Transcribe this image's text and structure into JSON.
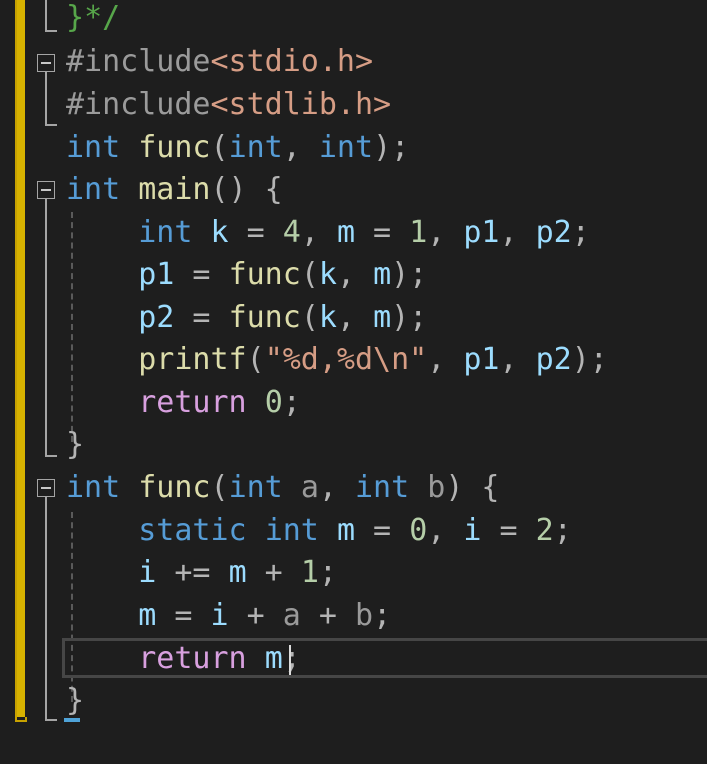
{
  "editor": {
    "lines": [
      {
        "tokens": [
          {
            "t": "}",
            "c": "tok-cmt"
          },
          {
            "t": "*/",
            "c": "tok-cmt"
          }
        ]
      },
      {
        "tokens": [
          {
            "t": "#include",
            "c": "tok-pre"
          },
          {
            "t": "<stdio.h>",
            "c": "tok-inc"
          }
        ]
      },
      {
        "tokens": [
          {
            "t": "#include",
            "c": "tok-pre"
          },
          {
            "t": "<stdlib.h>",
            "c": "tok-inc"
          }
        ]
      },
      {
        "tokens": [
          {
            "t": "int",
            "c": "tok-kw"
          },
          {
            "t": " ",
            "c": ""
          },
          {
            "t": "func",
            "c": "tok-fn"
          },
          {
            "t": "(",
            "c": "tok-punc"
          },
          {
            "t": "int",
            "c": "tok-kw"
          },
          {
            "t": ", ",
            "c": "tok-punc"
          },
          {
            "t": "int",
            "c": "tok-kw"
          },
          {
            "t": ");",
            "c": "tok-punc"
          }
        ]
      },
      {
        "tokens": [
          {
            "t": "int",
            "c": "tok-kw"
          },
          {
            "t": " ",
            "c": ""
          },
          {
            "t": "main",
            "c": "tok-fn"
          },
          {
            "t": "() {",
            "c": "tok-punc"
          }
        ]
      },
      {
        "tokens": [
          {
            "t": "    ",
            "c": ""
          },
          {
            "t": "int",
            "c": "tok-kw"
          },
          {
            "t": " ",
            "c": ""
          },
          {
            "t": "k",
            "c": "tok-var"
          },
          {
            "t": " = ",
            "c": "tok-punc"
          },
          {
            "t": "4",
            "c": "tok-num"
          },
          {
            "t": ", ",
            "c": "tok-punc"
          },
          {
            "t": "m",
            "c": "tok-var"
          },
          {
            "t": " = ",
            "c": "tok-punc"
          },
          {
            "t": "1",
            "c": "tok-num"
          },
          {
            "t": ", ",
            "c": "tok-punc"
          },
          {
            "t": "p1",
            "c": "tok-var"
          },
          {
            "t": ", ",
            "c": "tok-punc"
          },
          {
            "t": "p2",
            "c": "tok-var"
          },
          {
            "t": ";",
            "c": "tok-punc"
          }
        ]
      },
      {
        "tokens": [
          {
            "t": "    ",
            "c": ""
          },
          {
            "t": "p1",
            "c": "tok-var"
          },
          {
            "t": " = ",
            "c": "tok-punc"
          },
          {
            "t": "func",
            "c": "tok-fn"
          },
          {
            "t": "(",
            "c": "tok-punc"
          },
          {
            "t": "k",
            "c": "tok-var"
          },
          {
            "t": ", ",
            "c": "tok-punc"
          },
          {
            "t": "m",
            "c": "tok-var"
          },
          {
            "t": ");",
            "c": "tok-punc"
          }
        ]
      },
      {
        "tokens": [
          {
            "t": "    ",
            "c": ""
          },
          {
            "t": "p2",
            "c": "tok-var"
          },
          {
            "t": " = ",
            "c": "tok-punc"
          },
          {
            "t": "func",
            "c": "tok-fn"
          },
          {
            "t": "(",
            "c": "tok-punc"
          },
          {
            "t": "k",
            "c": "tok-var"
          },
          {
            "t": ", ",
            "c": "tok-punc"
          },
          {
            "t": "m",
            "c": "tok-var"
          },
          {
            "t": ");",
            "c": "tok-punc"
          }
        ]
      },
      {
        "tokens": [
          {
            "t": "    ",
            "c": ""
          },
          {
            "t": "printf",
            "c": "tok-fn"
          },
          {
            "t": "(",
            "c": "tok-punc"
          },
          {
            "t": "\"%d,%d\\n\"",
            "c": "tok-str"
          },
          {
            "t": ", ",
            "c": "tok-punc"
          },
          {
            "t": "p1",
            "c": "tok-var"
          },
          {
            "t": ", ",
            "c": "tok-punc"
          },
          {
            "t": "p2",
            "c": "tok-var"
          },
          {
            "t": ");",
            "c": "tok-punc"
          }
        ]
      },
      {
        "tokens": [
          {
            "t": "    ",
            "c": ""
          },
          {
            "t": "return",
            "c": "tok-ctrl"
          },
          {
            "t": " ",
            "c": ""
          },
          {
            "t": "0",
            "c": "tok-num"
          },
          {
            "t": ";",
            "c": "tok-punc"
          }
        ]
      },
      {
        "tokens": [
          {
            "t": "}",
            "c": "tok-punc"
          }
        ]
      },
      {
        "tokens": [
          {
            "t": "int",
            "c": "tok-kw"
          },
          {
            "t": " ",
            "c": ""
          },
          {
            "t": "func",
            "c": "tok-fn"
          },
          {
            "t": "(",
            "c": "tok-punc"
          },
          {
            "t": "int",
            "c": "tok-kw"
          },
          {
            "t": " ",
            "c": ""
          },
          {
            "t": "a",
            "c": "tok-param"
          },
          {
            "t": ", ",
            "c": "tok-punc"
          },
          {
            "t": "int",
            "c": "tok-kw"
          },
          {
            "t": " ",
            "c": ""
          },
          {
            "t": "b",
            "c": "tok-param"
          },
          {
            "t": ") {",
            "c": "tok-punc"
          }
        ]
      },
      {
        "tokens": [
          {
            "t": "    ",
            "c": ""
          },
          {
            "t": "static",
            "c": "tok-kw"
          },
          {
            "t": " ",
            "c": ""
          },
          {
            "t": "int",
            "c": "tok-kw"
          },
          {
            "t": " ",
            "c": ""
          },
          {
            "t": "m",
            "c": "tok-var"
          },
          {
            "t": " = ",
            "c": "tok-punc"
          },
          {
            "t": "0",
            "c": "tok-num"
          },
          {
            "t": ", ",
            "c": "tok-punc"
          },
          {
            "t": "i",
            "c": "tok-var"
          },
          {
            "t": " = ",
            "c": "tok-punc"
          },
          {
            "t": "2",
            "c": "tok-num"
          },
          {
            "t": ";",
            "c": "tok-punc"
          }
        ]
      },
      {
        "tokens": [
          {
            "t": "    ",
            "c": ""
          },
          {
            "t": "i",
            "c": "tok-var"
          },
          {
            "t": " += ",
            "c": "tok-punc"
          },
          {
            "t": "m",
            "c": "tok-var"
          },
          {
            "t": " + ",
            "c": "tok-punc"
          },
          {
            "t": "1",
            "c": "tok-num"
          },
          {
            "t": ";",
            "c": "tok-punc"
          }
        ]
      },
      {
        "tokens": [
          {
            "t": "    ",
            "c": ""
          },
          {
            "t": "m",
            "c": "tok-var"
          },
          {
            "t": " = ",
            "c": "tok-punc"
          },
          {
            "t": "i",
            "c": "tok-var"
          },
          {
            "t": " + ",
            "c": "tok-punc"
          },
          {
            "t": "a",
            "c": "tok-param"
          },
          {
            "t": " + ",
            "c": "tok-punc"
          },
          {
            "t": "b",
            "c": "tok-param"
          },
          {
            "t": ";",
            "c": "tok-punc"
          }
        ]
      },
      {
        "tokens": [
          {
            "t": "    ",
            "c": ""
          },
          {
            "t": "return",
            "c": "tok-ctrl"
          },
          {
            "t": " ",
            "c": ""
          },
          {
            "t": "m",
            "c": "tok-var"
          },
          {
            "t": ";",
            "c": "tok-punc"
          }
        ]
      },
      {
        "tokens": [
          {
            "t": "}",
            "c": "tok-punc"
          }
        ]
      }
    ],
    "fold_icons": [
      "collapse-icon",
      "collapse-icon",
      "collapse-icon"
    ],
    "colors": {
      "background": "#1e1e1e",
      "keyword": "#569cd6",
      "control_keyword": "#d8a0df",
      "function": "#dcdcaa",
      "variable": "#9cdcfe",
      "parameter": "#9a9a9a",
      "number": "#b5cea8",
      "string": "#d69d85",
      "preprocessor": "#9b9b9b",
      "comment": "#57a64a",
      "change_bar": "#d7b200"
    }
  }
}
